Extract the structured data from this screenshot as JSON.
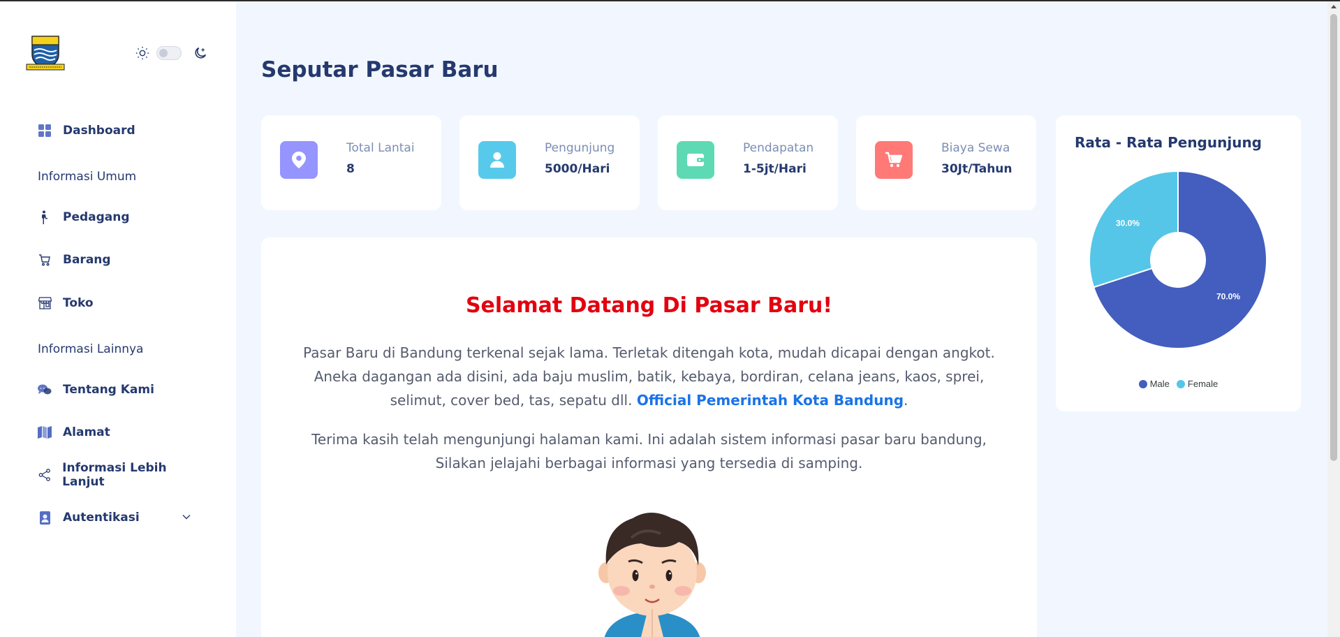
{
  "sidebar": {
    "logo_name": "bandung-city-logo",
    "menu": {
      "dashboard": "Dashboard",
      "section_general": "Informasi Umum",
      "pedagang": "Pedagang",
      "barang": "Barang",
      "toko": "Toko",
      "section_other": "Informasi Lainnya",
      "tentang": "Tentang Kami",
      "alamat": "Alamat",
      "lebih_lanjut": "Informasi Lebih Lanjut",
      "autentikasi": "Autentikasi"
    }
  },
  "page": {
    "title": "Seputar Pasar Baru"
  },
  "stats": [
    {
      "label": "Total Lantai",
      "value": "8",
      "color": "#9694ff",
      "icon": "location-pin-icon"
    },
    {
      "label": "Pengunjung",
      "value": "5000/Hari",
      "color": "#57caeb",
      "icon": "user-icon"
    },
    {
      "label": "Pendapatan",
      "value": "1-5jt/Hari",
      "color": "#5ddab4",
      "icon": "wallet-icon"
    },
    {
      "label": "Biaya Sewa",
      "value": "30Jt/Tahun",
      "color": "#ff7976",
      "icon": "cart-icon"
    }
  ],
  "chart": {
    "title": "Rata - Rata Pengunjung"
  },
  "chart_data": {
    "type": "pie",
    "categories": [
      "Male",
      "Female"
    ],
    "values": [
      70.0,
      30.0
    ],
    "data_labels": [
      "70.0%",
      "30.0%"
    ],
    "colors": [
      "#435ebe",
      "#55c6e8"
    ],
    "donut": true,
    "legend": "bottom"
  },
  "welcome": {
    "title": "Selamat Datang Di Pasar Baru!",
    "p1_text": "Pasar Baru di Bandung terkenal sejak lama. Terletak ditengah kota, mudah dicapai dengan angkot. Aneka dagangan ada disini, ada baju muslim, batik, kebaya, bordiran, celana jeans, kaos, sprei, selimut, cover bed, tas, sepatu dll. ",
    "p1_link": "Official Pemerintah Kota Bandung",
    "p1_end": ".",
    "p2": "Terima kasih telah mengunjungi halaman kami. Ini adalah sistem informasi pasar baru bandung, Silakan jelajahi berbagai informasi yang tersedia di samping."
  }
}
